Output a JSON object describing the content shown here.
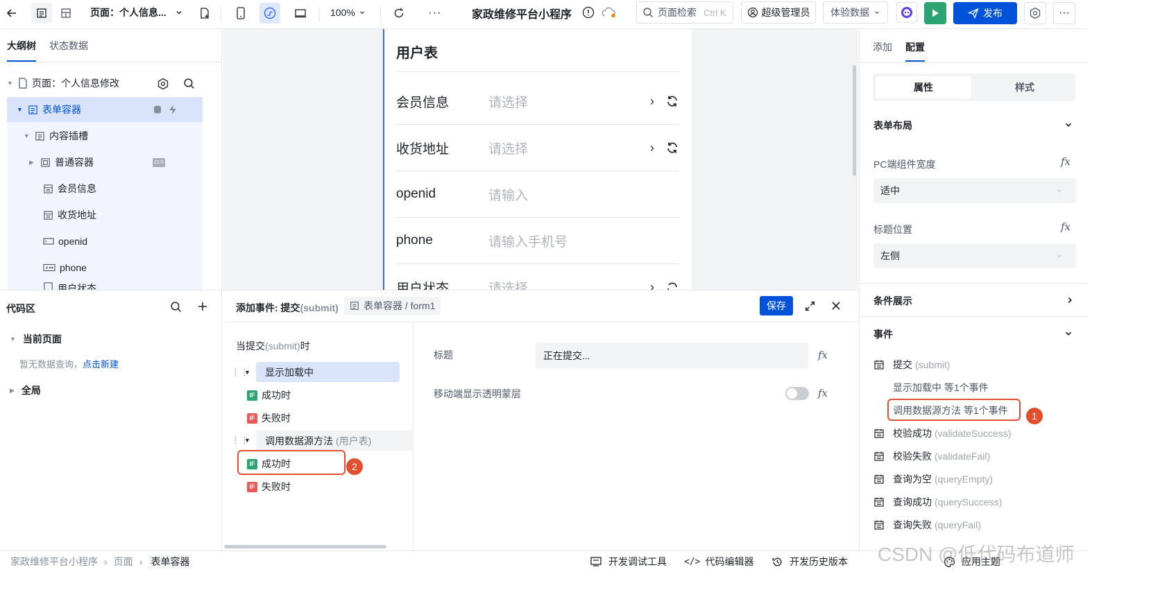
{
  "topbar": {
    "page_label": "页面：个人信息...",
    "zoom": "100%",
    "app_title": "家政维修平台小程序",
    "search_placeholder": "页面检索",
    "search_shortcut": "Ctrl K",
    "role": "超级管理员",
    "data_mode": "体验数据",
    "publish": "发布"
  },
  "outline": {
    "tabs": [
      "大纲树",
      "状态数据"
    ],
    "items": [
      {
        "label": "页面：个人信息修改"
      },
      {
        "label": "表单容器"
      },
      {
        "label": "内容插槽"
      },
      {
        "label": "普通容器",
        "badge": "CLS"
      },
      {
        "label": "会员信息"
      },
      {
        "label": "收货地址"
      },
      {
        "label": "openid"
      },
      {
        "label": "phone"
      },
      {
        "label": "用户状态"
      }
    ]
  },
  "preview": {
    "title": "用户表",
    "rows": [
      {
        "label": "会员信息",
        "placeholder": "请选择"
      },
      {
        "label": "收货地址",
        "placeholder": "请选择"
      },
      {
        "label": "openid",
        "placeholder": "请输入"
      },
      {
        "label": "phone",
        "placeholder": "请输入手机号"
      },
      {
        "label": "用户状态",
        "placeholder": "请选择"
      }
    ]
  },
  "right": {
    "tabs": [
      "添加",
      "配置"
    ],
    "seg": [
      "属性",
      "样式"
    ],
    "form_layout": "表单布局",
    "pc_width_label": "PC端组件宽度",
    "pc_width_value": "适中",
    "title_pos_label": "标题位置",
    "title_pos_value": "左侧",
    "cond_show": "条件展示",
    "events_title": "事件",
    "submit_event": "提交",
    "submit_event_en": "(submit)",
    "sub1": "显示加载中 等1个事件",
    "sub2": "调用数据源方法 等1个事件",
    "events": [
      {
        "label": "校验成功",
        "en": "(validateSuccess)"
      },
      {
        "label": "校验失败",
        "en": "(validateFail)"
      },
      {
        "label": "查询为空",
        "en": "(queryEmpty)"
      },
      {
        "label": "查询成功",
        "en": "(querySuccess)"
      },
      {
        "label": "查询失败",
        "en": "(queryFail)"
      }
    ],
    "badge1": "1"
  },
  "code_area": {
    "title": "代码区",
    "current_page": "当前页面",
    "empty_text": "暂无数据查询，",
    "new_link": "点击新建",
    "global": "全局"
  },
  "event_panel": {
    "title": "添加事件: 提交",
    "title_en": "(submit)",
    "crumb": "表单容器 / form1",
    "save": "保存",
    "when_prefix": "当提交",
    "when_en": "(submit)",
    "when_suffix": "时",
    "action1": "显示加载中",
    "success1": "成功时",
    "fail1": "失败时",
    "action2": "调用数据源方法",
    "action2_src": "(用户表)",
    "success2": "成功时",
    "fail2": "失败时",
    "badge2": "2",
    "field_title_label": "标题",
    "field_title_value": "正在提交...",
    "mask_label": "移动端显示透明蒙层"
  },
  "bottom": {
    "crumbs": [
      "家政维修平台小程序",
      "页面",
      "表单容器"
    ],
    "dev_tools": "开发调试工具",
    "code_editor": "代码编辑器",
    "history": "开发历史版本",
    "theme": "应用主题"
  },
  "watermark": "CSDN @低代码布道师"
}
